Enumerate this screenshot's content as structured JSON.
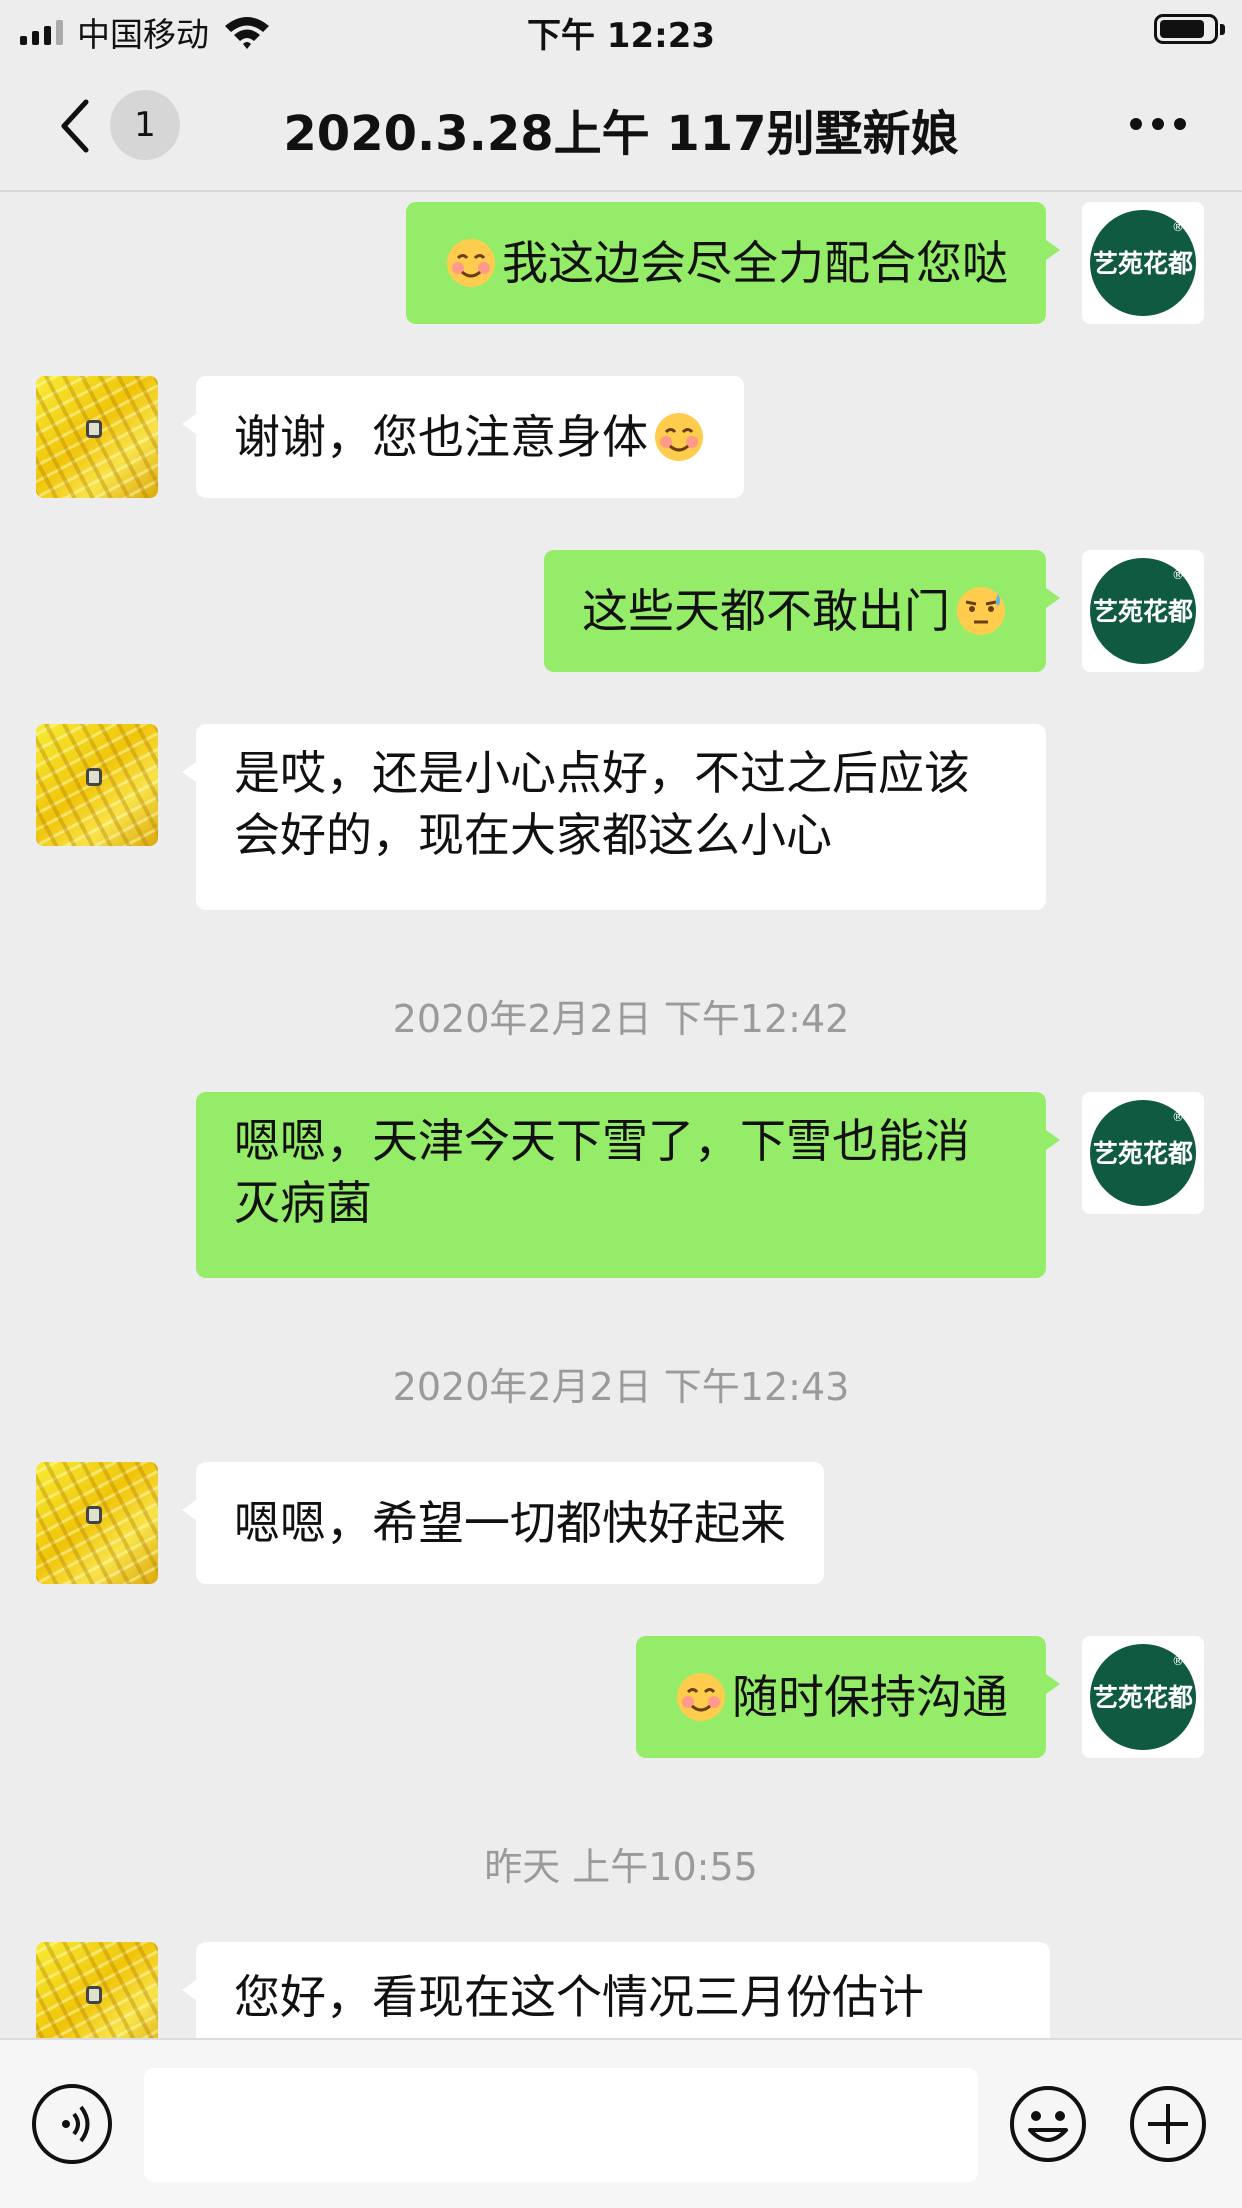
{
  "status_bar": {
    "carrier": "中国移动",
    "time": "下午 12:23",
    "battery_level": 0.85
  },
  "nav": {
    "back_icon": "chevron-left-icon",
    "unread_count": "1",
    "title": "2020.3.28上午 117别墅新娘",
    "more_icon": "more-dots-icon"
  },
  "my_avatar": {
    "line1": "艺苑",
    "line2": "花都",
    "mark": "®",
    "color": "#0f5a40"
  },
  "messages": [
    {
      "sender": "me",
      "emoji_lead": "smiling-blush-emoji",
      "text": "我这边会尽全力配合您哒"
    },
    {
      "sender": "them",
      "text": "谢谢，您也注意身体",
      "emoji_trail": "smiling-blush-emoji"
    },
    {
      "sender": "me",
      "text": "这些天都不敢出门",
      "emoji_trail": "sweat-rolling-eyes-emoji"
    },
    {
      "sender": "them",
      "text": "是哎，还是小心点好，不过之后应该会好的，现在大家都这么小心"
    },
    {
      "timestamp": "2020年2月2日 下午12:42"
    },
    {
      "sender": "me",
      "text": "嗯嗯，天津今天下雪了，下雪也能消灭病菌"
    },
    {
      "timestamp": "2020年2月2日 下午12:43"
    },
    {
      "sender": "them",
      "text": "嗯嗯，希望一切都快好起来"
    },
    {
      "sender": "me",
      "emoji_lead": "smiling-blush-emoji",
      "text": "随时保持沟通"
    },
    {
      "timestamp": "昨天 上午10:55"
    },
    {
      "sender": "them",
      "text": "您好，看现在这个情况三月份估计"
    }
  ],
  "input_bar": {
    "voice_icon": "voice-icon",
    "text_value": "",
    "emoji_icon": "emoji-face-icon",
    "plus_icon": "plus-circle-icon"
  },
  "colors": {
    "my_bubble": "#95ec69",
    "their_bubble": "#ffffff",
    "background": "#ededed",
    "timestamp": "#9a9a9a"
  }
}
